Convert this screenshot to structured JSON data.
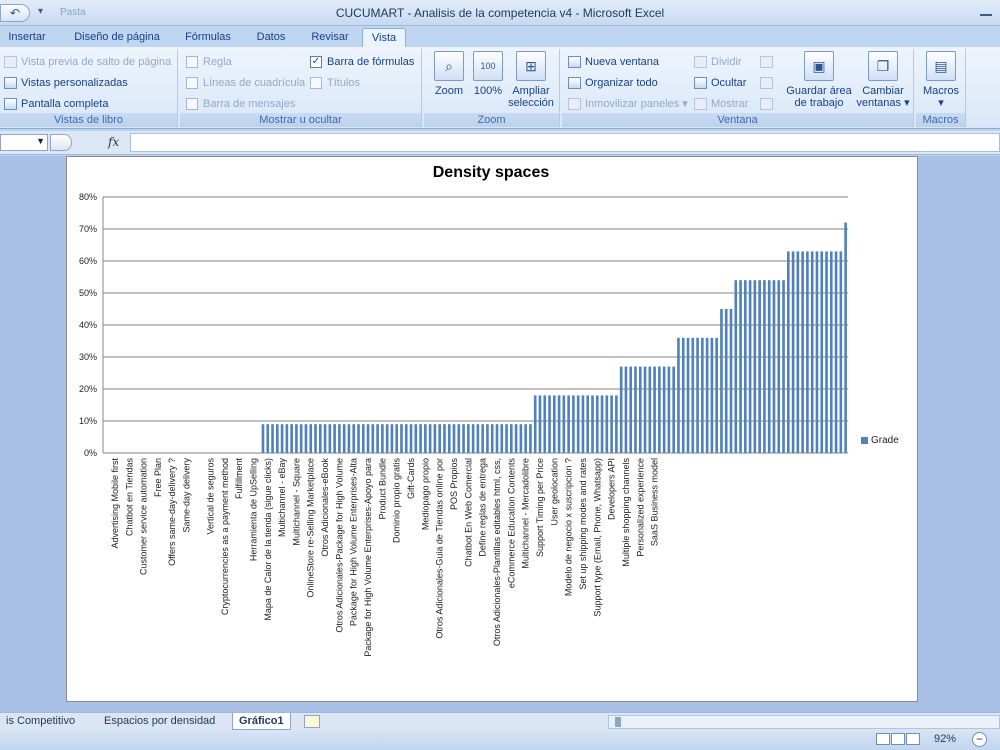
{
  "window": {
    "title": "CUCUMART - Analisis de la competencia v4 - Microsoft Excel",
    "qat_ghost": "Pasta"
  },
  "tabs": [
    {
      "label": "Insertar"
    },
    {
      "label": "Diseño de página"
    },
    {
      "label": "Fórmulas"
    },
    {
      "label": "Datos"
    },
    {
      "label": "Revisar"
    },
    {
      "label": "Vista"
    }
  ],
  "ribbon": {
    "vistas": {
      "label": "Vistas de libro",
      "items": [
        "Vista previa de salto de página",
        "Vistas personalizadas",
        "Pantalla completa"
      ]
    },
    "mostrar": {
      "label": "Mostrar u ocultar",
      "regla": "Regla",
      "lineas": "Líneas de cuadrícula",
      "barra_mensajes": "Barra de mensajes",
      "barra_formulas": "Barra de fórmulas",
      "titulos": "Títulos"
    },
    "zoom": {
      "label": "Zoom",
      "zoom_btn": "Zoom",
      "hundred_btn": "100%",
      "hundred_icon": "100",
      "ampliar_1": "Ampliar",
      "ampliar_2": "selección"
    },
    "ventana": {
      "label": "Ventana",
      "nueva": "Nueva ventana",
      "organizar": "Organizar todo",
      "inmovilizar": "Inmovilizar paneles",
      "dividir": "Dividir",
      "ocultar": "Ocultar",
      "mostrar": "Mostrar",
      "guardar_1": "Guardar área",
      "guardar_2": "de trabajo",
      "cambiar_1": "Cambiar",
      "cambiar_2": "ventanas"
    },
    "macros": {
      "label": "Macros",
      "btn": "Macros"
    }
  },
  "formula_bar": {
    "fx": "fx"
  },
  "chart_data": {
    "type": "bar",
    "title": "Density spaces",
    "xlabel": "",
    "ylabel": "",
    "ylim": [
      0,
      80
    ],
    "yticks": [
      0,
      10,
      20,
      30,
      40,
      50,
      60,
      70,
      80
    ],
    "ytick_labels": [
      "0%",
      "10%",
      "20%",
      "30%",
      "40%",
      "50%",
      "60%",
      "70%",
      "80%"
    ],
    "grid": true,
    "legend_position": "right",
    "bar_color": "#4f81bd",
    "series": [
      {
        "name": "Grade",
        "values": [
          0,
          0,
          0,
          0,
          0,
          0,
          0,
          0,
          0,
          0,
          0,
          0,
          0,
          0,
          0,
          0,
          0,
          0,
          0,
          0,
          0,
          0,
          0,
          0,
          0,
          0,
          0,
          0,
          0,
          0,
          0,
          0,
          0,
          9,
          9,
          9,
          9,
          9,
          9,
          9,
          9,
          9,
          9,
          9,
          9,
          9,
          9,
          9,
          9,
          9,
          9,
          9,
          9,
          9,
          9,
          9,
          9,
          9,
          9,
          9,
          9,
          9,
          9,
          9,
          9,
          9,
          9,
          9,
          9,
          9,
          9,
          9,
          9,
          9,
          9,
          9,
          9,
          9,
          9,
          9,
          9,
          9,
          9,
          9,
          9,
          9,
          9,
          9,
          9,
          9,
          18,
          18,
          18,
          18,
          18,
          18,
          18,
          18,
          18,
          18,
          18,
          18,
          18,
          18,
          18,
          18,
          18,
          18,
          27,
          27,
          27,
          27,
          27,
          27,
          27,
          27,
          27,
          27,
          27,
          27,
          36,
          36,
          36,
          36,
          36,
          36,
          36,
          36,
          36,
          45,
          45,
          45,
          54,
          54,
          54,
          54,
          54,
          54,
          54,
          54,
          54,
          54,
          54,
          63,
          63,
          63,
          63,
          63,
          63,
          63,
          63,
          63,
          63,
          63,
          63,
          72
        ]
      }
    ],
    "category_labels": [
      {
        "index": 2,
        "text": "Advertising Mobile first"
      },
      {
        "index": 5,
        "text": "Chatbot en Tiendas"
      },
      {
        "index": 8,
        "text": "Customer service automation"
      },
      {
        "index": 11,
        "text": "Free Plan"
      },
      {
        "index": 14,
        "text": "Offers same-day-delivery ?"
      },
      {
        "index": 17,
        "text": "Same-day delivery"
      },
      {
        "index": 22,
        "text": "Vertical de seguros"
      },
      {
        "index": 25,
        "text": "Cryptocurrencies as a payment method"
      },
      {
        "index": 28,
        "text": "Fulfillment"
      },
      {
        "index": 31,
        "text": "Herramienta de UpSelling"
      },
      {
        "index": 34,
        "text": "Mapa de Calor de la tienda (sigue clicks)"
      },
      {
        "index": 37,
        "text": "Multichannel - eBay"
      },
      {
        "index": 40,
        "text": "Multichannel - Square"
      },
      {
        "index": 43,
        "text": "OnlineStore re-Selling Marketplace"
      },
      {
        "index": 46,
        "text": "Otros Adicionales-eBook"
      },
      {
        "index": 49,
        "text": "Otros Adicionales-Package for High Volume"
      },
      {
        "index": 52,
        "text": "Package for High Volume Enterprises-Alta"
      },
      {
        "index": 55,
        "text": "Package for High Volume Enterprises-Apoyo para"
      },
      {
        "index": 58,
        "text": "Product Bundle"
      },
      {
        "index": 61,
        "text": "Dominio propio gratis"
      },
      {
        "index": 64,
        "text": "Gift-Cards"
      },
      {
        "index": 67,
        "text": "Mediopago propio"
      },
      {
        "index": 70,
        "text": "Otros Adicionales-Guia de Tiendas online por"
      },
      {
        "index": 73,
        "text": "POS Propios"
      },
      {
        "index": 76,
        "text": "Chatbot En Web Comercial"
      },
      {
        "index": 79,
        "text": "Define reglas de entrega"
      },
      {
        "index": 82,
        "text": "Otros Adicionales-Plantillas editables html, css,"
      },
      {
        "index": 85,
        "text": "eCommerce Education Contents"
      },
      {
        "index": 88,
        "text": "Multichannel - Mercadolibre"
      },
      {
        "index": 91,
        "text": "Support Timing per Price"
      },
      {
        "index": 94,
        "text": "User geolocation"
      },
      {
        "index": 97,
        "text": "Modelo de negocio x suscripcion ?"
      },
      {
        "index": 100,
        "text": "Set up shipping modes and rates"
      },
      {
        "index": 103,
        "text": "Support type (Email, Phone, Whatsapp)"
      },
      {
        "index": 106,
        "text": "Developers API"
      },
      {
        "index": 109,
        "text": "Multiple shopping channels"
      },
      {
        "index": 112,
        "text": "Personalized experience"
      },
      {
        "index": 115,
        "text": "SaaS Business model"
      }
    ]
  },
  "sheets": [
    {
      "label": "is Competitivo"
    },
    {
      "label": "Espacios por densidad"
    },
    {
      "label": "Gráfico1"
    }
  ],
  "status": {
    "zoom": "92%"
  }
}
